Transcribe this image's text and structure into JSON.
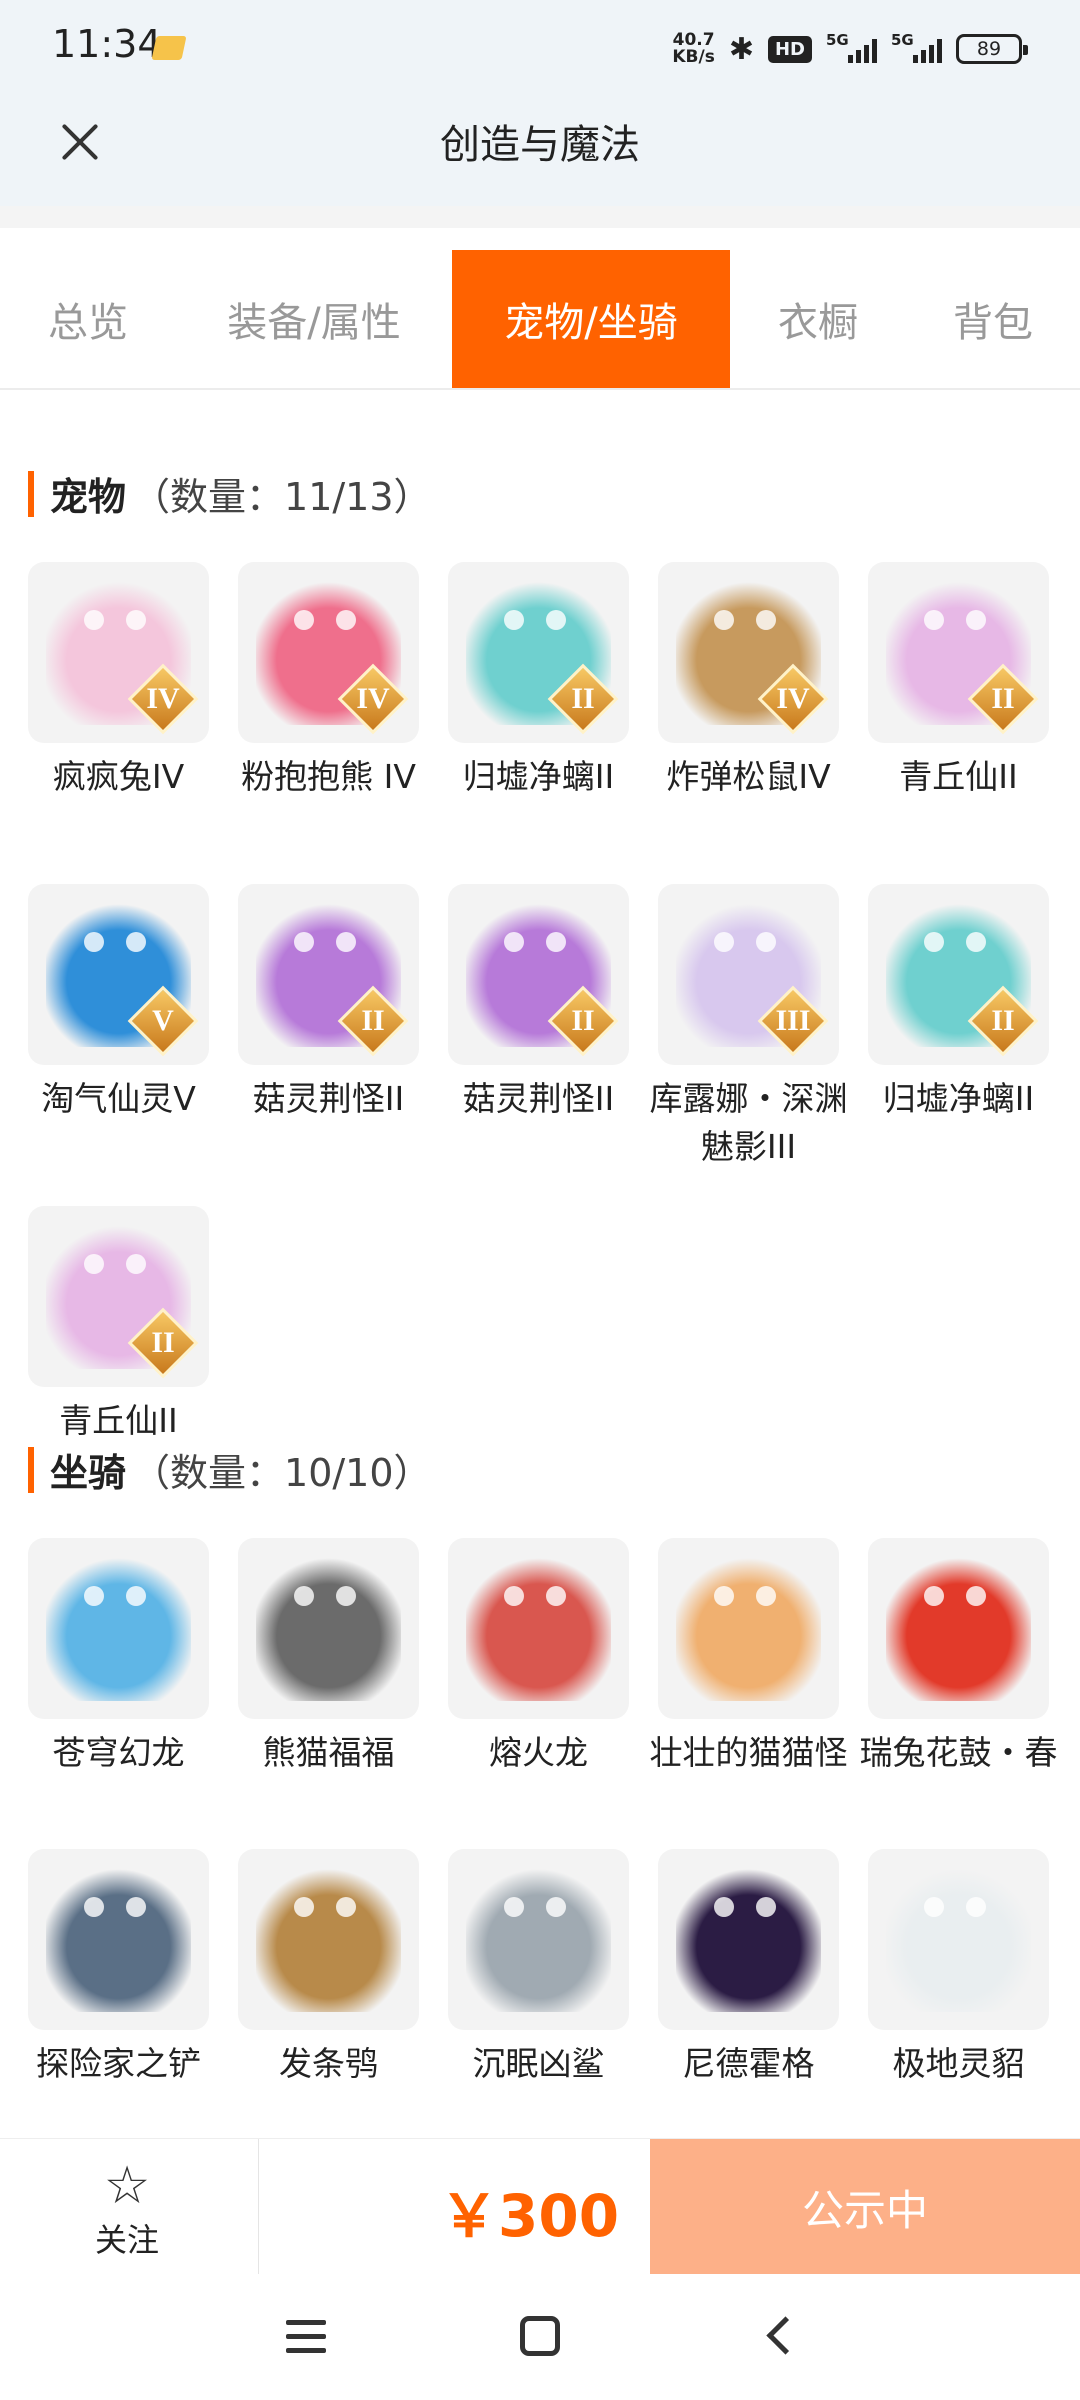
{
  "status_bar": {
    "time": "11:34",
    "net_speed_value": "40.7",
    "net_speed_unit": "KB/s",
    "hd_label": "HD",
    "network_1": "5G",
    "network_2": "5G",
    "battery": "89"
  },
  "header": {
    "title": "创造与魔法"
  },
  "tabs": [
    {
      "label": "总览"
    },
    {
      "label": "装备/属性"
    },
    {
      "label": "宠物/坐骑",
      "active": true
    },
    {
      "label": "衣橱"
    },
    {
      "label": "背包"
    }
  ],
  "pets": {
    "title": "宠物",
    "count": "（数量：11/13）",
    "items": [
      {
        "name": "疯疯兔IV",
        "rank": "IV",
        "color": "#f4c6dc"
      },
      {
        "name": "粉抱抱熊 IV",
        "rank": "IV",
        "color": "#ef6f8c"
      },
      {
        "name": "归墟净螭II",
        "rank": "II",
        "color": "#6fd0cf"
      },
      {
        "name": "炸弹松鼠IV",
        "rank": "IV",
        "color": "#c79a5e"
      },
      {
        "name": "青丘仙II",
        "rank": "II",
        "color": "#e7b8e6"
      },
      {
        "name": "淘气仙灵V",
        "rank": "V",
        "color": "#2f8fd9"
      },
      {
        "name": "菇灵荆怪II",
        "rank": "II",
        "color": "#b77ad9"
      },
      {
        "name": "菇灵荆怪II",
        "rank": "II",
        "color": "#b77ad9"
      },
      {
        "name": "库露娜・深渊魅影III",
        "rank": "III",
        "color": "#d8c8ee"
      },
      {
        "name": "归墟净螭II",
        "rank": "II",
        "color": "#6fd0cf"
      },
      {
        "name": "青丘仙II",
        "rank": "II",
        "color": "#e7b8e6"
      }
    ]
  },
  "mounts": {
    "title": "坐骑",
    "count": "（数量：10/10）",
    "items": [
      {
        "name": "苍穹幻龙",
        "color": "#5fb6e6"
      },
      {
        "name": "熊猫福福",
        "color": "#6b6b6b"
      },
      {
        "name": "熔火龙",
        "color": "#d9574f"
      },
      {
        "name": "壮壮的猫猫怪",
        "color": "#f0b070"
      },
      {
        "name": "瑞兔花鼓・春",
        "color": "#e23a2a"
      },
      {
        "name": "探险家之铲",
        "color": "#5a6f86"
      },
      {
        "name": "发条鸮",
        "color": "#b88a4a"
      },
      {
        "name": "沉眠凶鲨",
        "color": "#a0aab2"
      },
      {
        "name": "尼德霍格",
        "color": "#2b1c44"
      },
      {
        "name": "极地灵貂",
        "color": "#e9eef0"
      }
    ]
  },
  "bottom_bar": {
    "follow_label": "关注",
    "price": "￥300",
    "status_button": "公示中"
  },
  "colors": {
    "accent": "#ff6200",
    "status_button_bg": "#fdb088",
    "header_bg": "#eff4f8"
  },
  "icons": {
    "close": "close-icon",
    "follow": "star-icon",
    "bluetooth": "bluetooth-icon",
    "battery": "battery-icon"
  }
}
